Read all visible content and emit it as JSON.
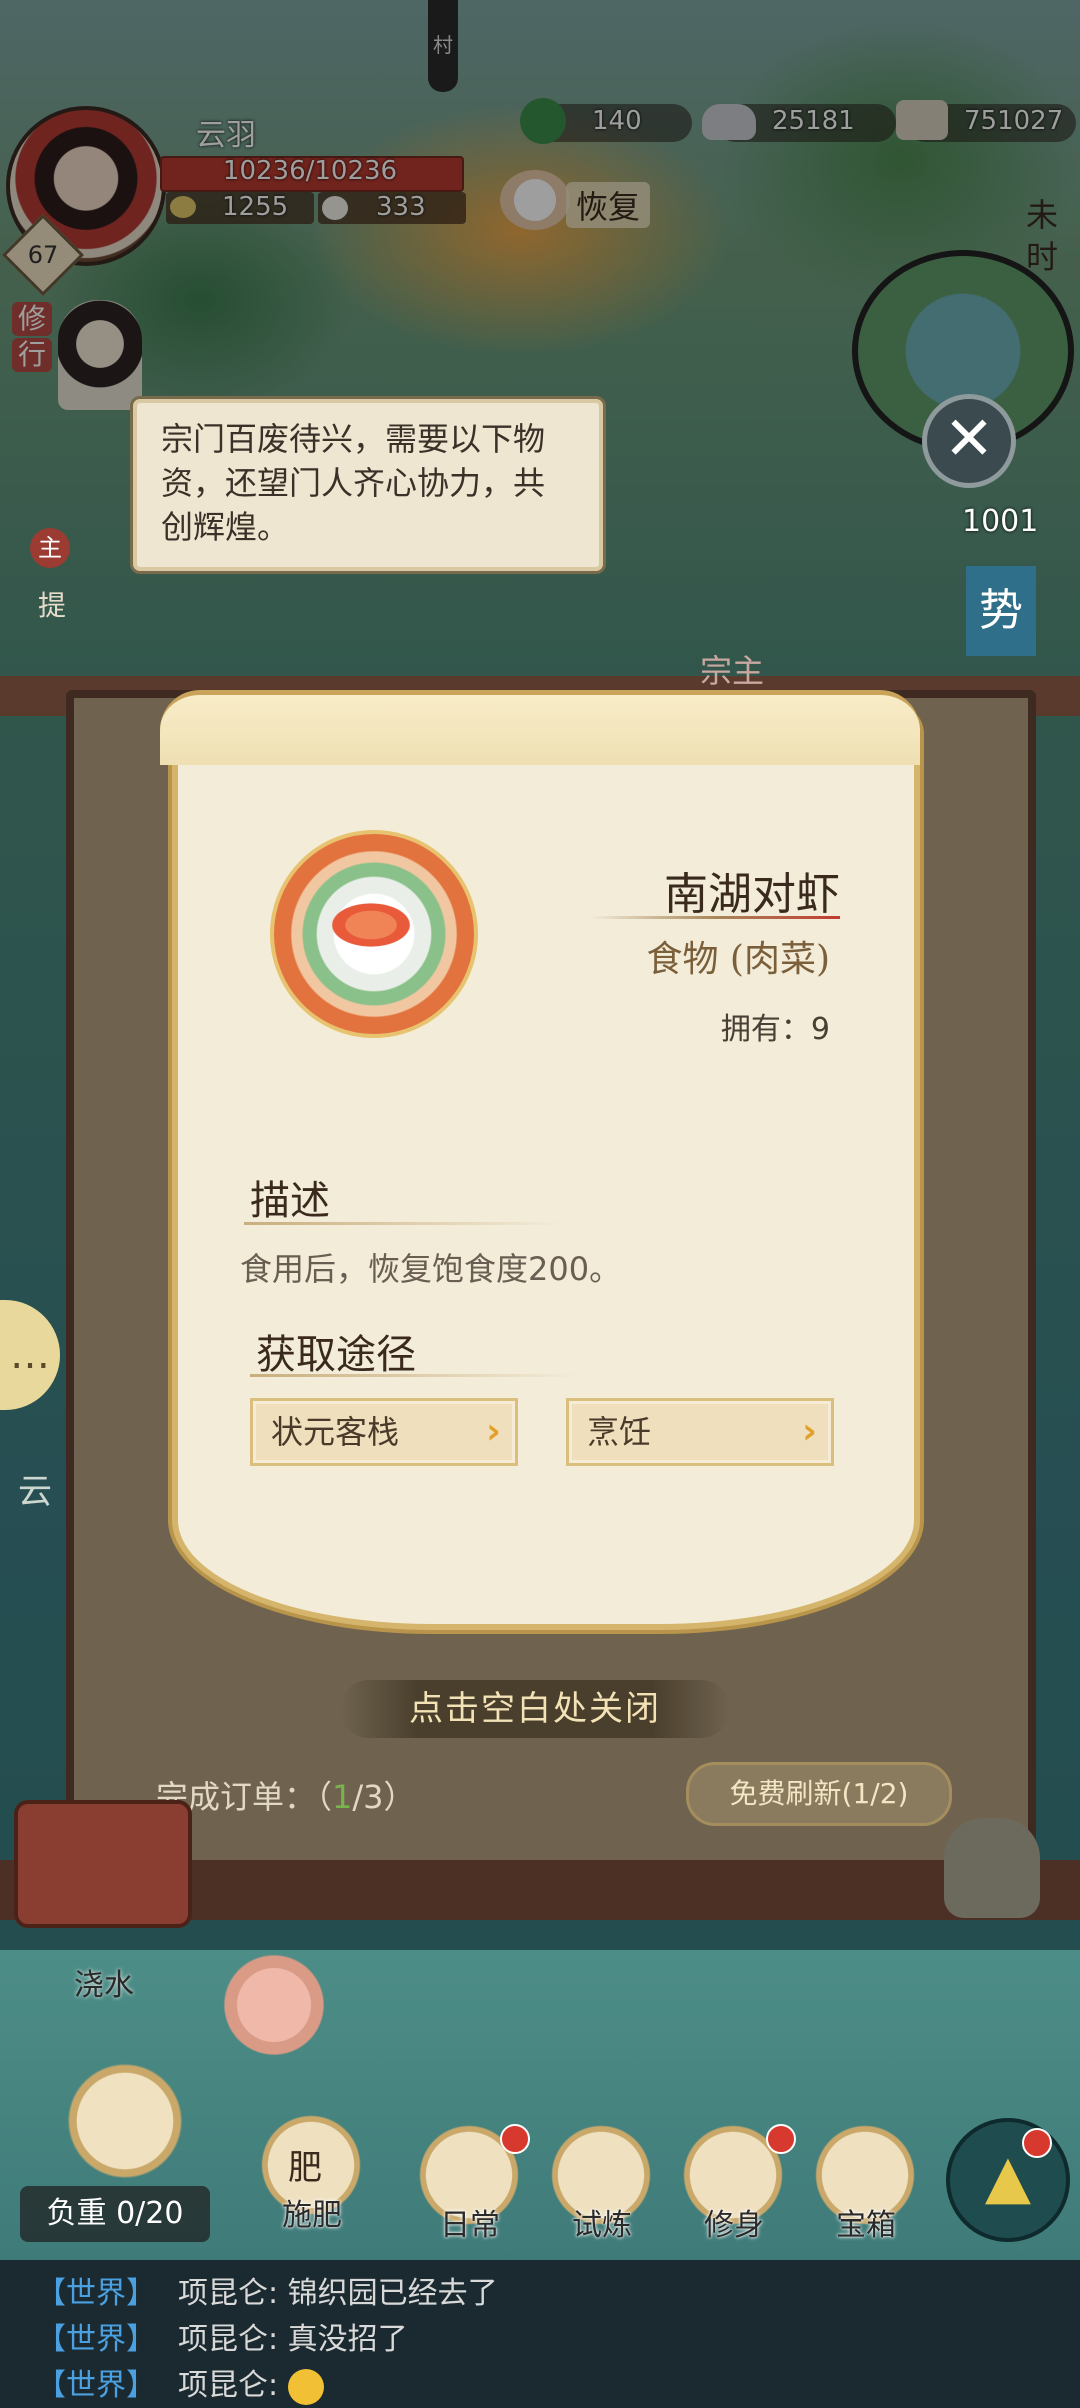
{
  "hud": {
    "player_name": "云羽",
    "hp": "10236/10236",
    "stat_a": "1255",
    "stat_b": "333",
    "level": "67",
    "res_1": "140",
    "res_2": "25181",
    "res_3": "751027",
    "recover_label": "恢复",
    "time_label_1": "未",
    "time_label_2": "时",
    "village_tag": "村",
    "side_tag_1": "修",
    "side_tag_2": "行",
    "count_1001": "1001",
    "side_char_shi": "势",
    "side_char_zhu": "主",
    "side_char_ti": "提",
    "side_char_yun": "云"
  },
  "bubble": {
    "text": "宗门百废待兴，需要以下物资，还望门人齐心协力，共创辉煌。"
  },
  "item": {
    "name": "南湖对虾",
    "type": "食物 (肉菜)",
    "owned": "拥有：9",
    "desc_title": "描述",
    "desc_text": "食用后，恢复饱食度200。",
    "source_title": "获取途径",
    "sources": [
      {
        "label": "状元客栈"
      },
      {
        "label": "烹饪"
      }
    ]
  },
  "dialog": {
    "close_hint": "点击空白处关闭",
    "order_prefix": "完成订单：",
    "order_open": "（",
    "order_done": "1",
    "order_rest": "/3）",
    "refresh_label": "免费刷新(1/2)",
    "under_title": "宗主"
  },
  "toolbar": {
    "water": "浇水",
    "fertilize": "施肥",
    "fertilize_icon_char": "肥",
    "daily": "日常",
    "trial": "试炼",
    "cultivate": "修身",
    "chest": "宝箱",
    "load": "负重 0/20"
  },
  "chat": [
    {
      "channel": "【世界】",
      "text": "项昆仑: 锦织园已经去了"
    },
    {
      "channel": "【世界】",
      "text": "项昆仑: 真没招了"
    },
    {
      "channel": "【世界】",
      "text": "项昆仑: "
    }
  ],
  "colors": {
    "accent_red": "#d8392f",
    "card_bg": "#f3ecd9",
    "arrow_orange": "#e3a12c",
    "chat_channel": "#4aa0e0"
  }
}
